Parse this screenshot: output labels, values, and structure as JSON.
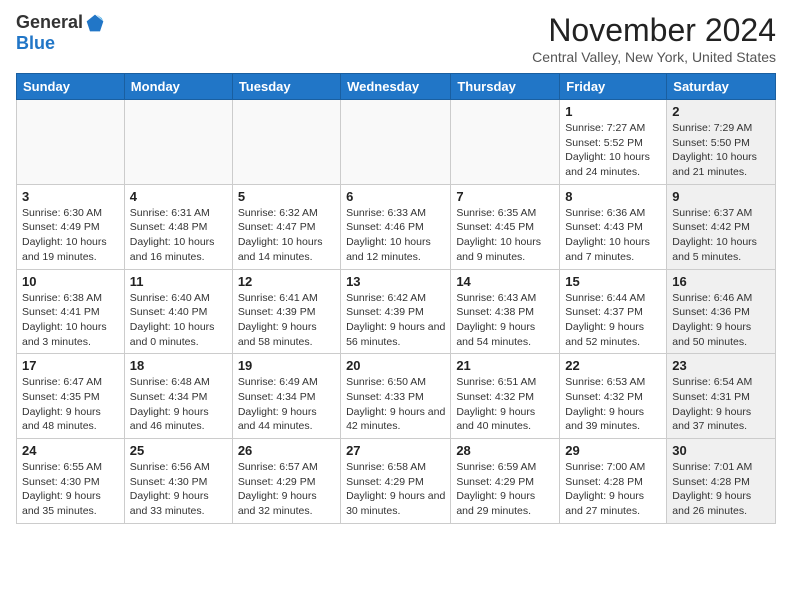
{
  "logo": {
    "general": "General",
    "blue": "Blue"
  },
  "title": "November 2024",
  "location": "Central Valley, New York, United States",
  "headers": [
    "Sunday",
    "Monday",
    "Tuesday",
    "Wednesday",
    "Thursday",
    "Friday",
    "Saturday"
  ],
  "weeks": [
    [
      {
        "day": "",
        "info": "",
        "shaded": false,
        "empty": true
      },
      {
        "day": "",
        "info": "",
        "shaded": false,
        "empty": true
      },
      {
        "day": "",
        "info": "",
        "shaded": false,
        "empty": true
      },
      {
        "day": "",
        "info": "",
        "shaded": false,
        "empty": true
      },
      {
        "day": "",
        "info": "",
        "shaded": false,
        "empty": true
      },
      {
        "day": "1",
        "info": "Sunrise: 7:27 AM\nSunset: 5:52 PM\nDaylight: 10 hours\nand 24 minutes.",
        "shaded": false,
        "empty": false
      },
      {
        "day": "2",
        "info": "Sunrise: 7:29 AM\nSunset: 5:50 PM\nDaylight: 10 hours\nand 21 minutes.",
        "shaded": true,
        "empty": false
      }
    ],
    [
      {
        "day": "3",
        "info": "Sunrise: 6:30 AM\nSunset: 4:49 PM\nDaylight: 10 hours\nand 19 minutes.",
        "shaded": false,
        "empty": false
      },
      {
        "day": "4",
        "info": "Sunrise: 6:31 AM\nSunset: 4:48 PM\nDaylight: 10 hours\nand 16 minutes.",
        "shaded": false,
        "empty": false
      },
      {
        "day": "5",
        "info": "Sunrise: 6:32 AM\nSunset: 4:47 PM\nDaylight: 10 hours\nand 14 minutes.",
        "shaded": false,
        "empty": false
      },
      {
        "day": "6",
        "info": "Sunrise: 6:33 AM\nSunset: 4:46 PM\nDaylight: 10 hours\nand 12 minutes.",
        "shaded": false,
        "empty": false
      },
      {
        "day": "7",
        "info": "Sunrise: 6:35 AM\nSunset: 4:45 PM\nDaylight: 10 hours\nand 9 minutes.",
        "shaded": false,
        "empty": false
      },
      {
        "day": "8",
        "info": "Sunrise: 6:36 AM\nSunset: 4:43 PM\nDaylight: 10 hours\nand 7 minutes.",
        "shaded": false,
        "empty": false
      },
      {
        "day": "9",
        "info": "Sunrise: 6:37 AM\nSunset: 4:42 PM\nDaylight: 10 hours\nand 5 minutes.",
        "shaded": true,
        "empty": false
      }
    ],
    [
      {
        "day": "10",
        "info": "Sunrise: 6:38 AM\nSunset: 4:41 PM\nDaylight: 10 hours\nand 3 minutes.",
        "shaded": false,
        "empty": false
      },
      {
        "day": "11",
        "info": "Sunrise: 6:40 AM\nSunset: 4:40 PM\nDaylight: 10 hours\nand 0 minutes.",
        "shaded": false,
        "empty": false
      },
      {
        "day": "12",
        "info": "Sunrise: 6:41 AM\nSunset: 4:39 PM\nDaylight: 9 hours\nand 58 minutes.",
        "shaded": false,
        "empty": false
      },
      {
        "day": "13",
        "info": "Sunrise: 6:42 AM\nSunset: 4:39 PM\nDaylight: 9 hours\nand 56 minutes.",
        "shaded": false,
        "empty": false
      },
      {
        "day": "14",
        "info": "Sunrise: 6:43 AM\nSunset: 4:38 PM\nDaylight: 9 hours\nand 54 minutes.",
        "shaded": false,
        "empty": false
      },
      {
        "day": "15",
        "info": "Sunrise: 6:44 AM\nSunset: 4:37 PM\nDaylight: 9 hours\nand 52 minutes.",
        "shaded": false,
        "empty": false
      },
      {
        "day": "16",
        "info": "Sunrise: 6:46 AM\nSunset: 4:36 PM\nDaylight: 9 hours\nand 50 minutes.",
        "shaded": true,
        "empty": false
      }
    ],
    [
      {
        "day": "17",
        "info": "Sunrise: 6:47 AM\nSunset: 4:35 PM\nDaylight: 9 hours\nand 48 minutes.",
        "shaded": false,
        "empty": false
      },
      {
        "day": "18",
        "info": "Sunrise: 6:48 AM\nSunset: 4:34 PM\nDaylight: 9 hours\nand 46 minutes.",
        "shaded": false,
        "empty": false
      },
      {
        "day": "19",
        "info": "Sunrise: 6:49 AM\nSunset: 4:34 PM\nDaylight: 9 hours\nand 44 minutes.",
        "shaded": false,
        "empty": false
      },
      {
        "day": "20",
        "info": "Sunrise: 6:50 AM\nSunset: 4:33 PM\nDaylight: 9 hours\nand 42 minutes.",
        "shaded": false,
        "empty": false
      },
      {
        "day": "21",
        "info": "Sunrise: 6:51 AM\nSunset: 4:32 PM\nDaylight: 9 hours\nand 40 minutes.",
        "shaded": false,
        "empty": false
      },
      {
        "day": "22",
        "info": "Sunrise: 6:53 AM\nSunset: 4:32 PM\nDaylight: 9 hours\nand 39 minutes.",
        "shaded": false,
        "empty": false
      },
      {
        "day": "23",
        "info": "Sunrise: 6:54 AM\nSunset: 4:31 PM\nDaylight: 9 hours\nand 37 minutes.",
        "shaded": true,
        "empty": false
      }
    ],
    [
      {
        "day": "24",
        "info": "Sunrise: 6:55 AM\nSunset: 4:30 PM\nDaylight: 9 hours\nand 35 minutes.",
        "shaded": false,
        "empty": false
      },
      {
        "day": "25",
        "info": "Sunrise: 6:56 AM\nSunset: 4:30 PM\nDaylight: 9 hours\nand 33 minutes.",
        "shaded": false,
        "empty": false
      },
      {
        "day": "26",
        "info": "Sunrise: 6:57 AM\nSunset: 4:29 PM\nDaylight: 9 hours\nand 32 minutes.",
        "shaded": false,
        "empty": false
      },
      {
        "day": "27",
        "info": "Sunrise: 6:58 AM\nSunset: 4:29 PM\nDaylight: 9 hours\nand 30 minutes.",
        "shaded": false,
        "empty": false
      },
      {
        "day": "28",
        "info": "Sunrise: 6:59 AM\nSunset: 4:29 PM\nDaylight: 9 hours\nand 29 minutes.",
        "shaded": false,
        "empty": false
      },
      {
        "day": "29",
        "info": "Sunrise: 7:00 AM\nSunset: 4:28 PM\nDaylight: 9 hours\nand 27 minutes.",
        "shaded": false,
        "empty": false
      },
      {
        "day": "30",
        "info": "Sunrise: 7:01 AM\nSunset: 4:28 PM\nDaylight: 9 hours\nand 26 minutes.",
        "shaded": true,
        "empty": false
      }
    ]
  ]
}
